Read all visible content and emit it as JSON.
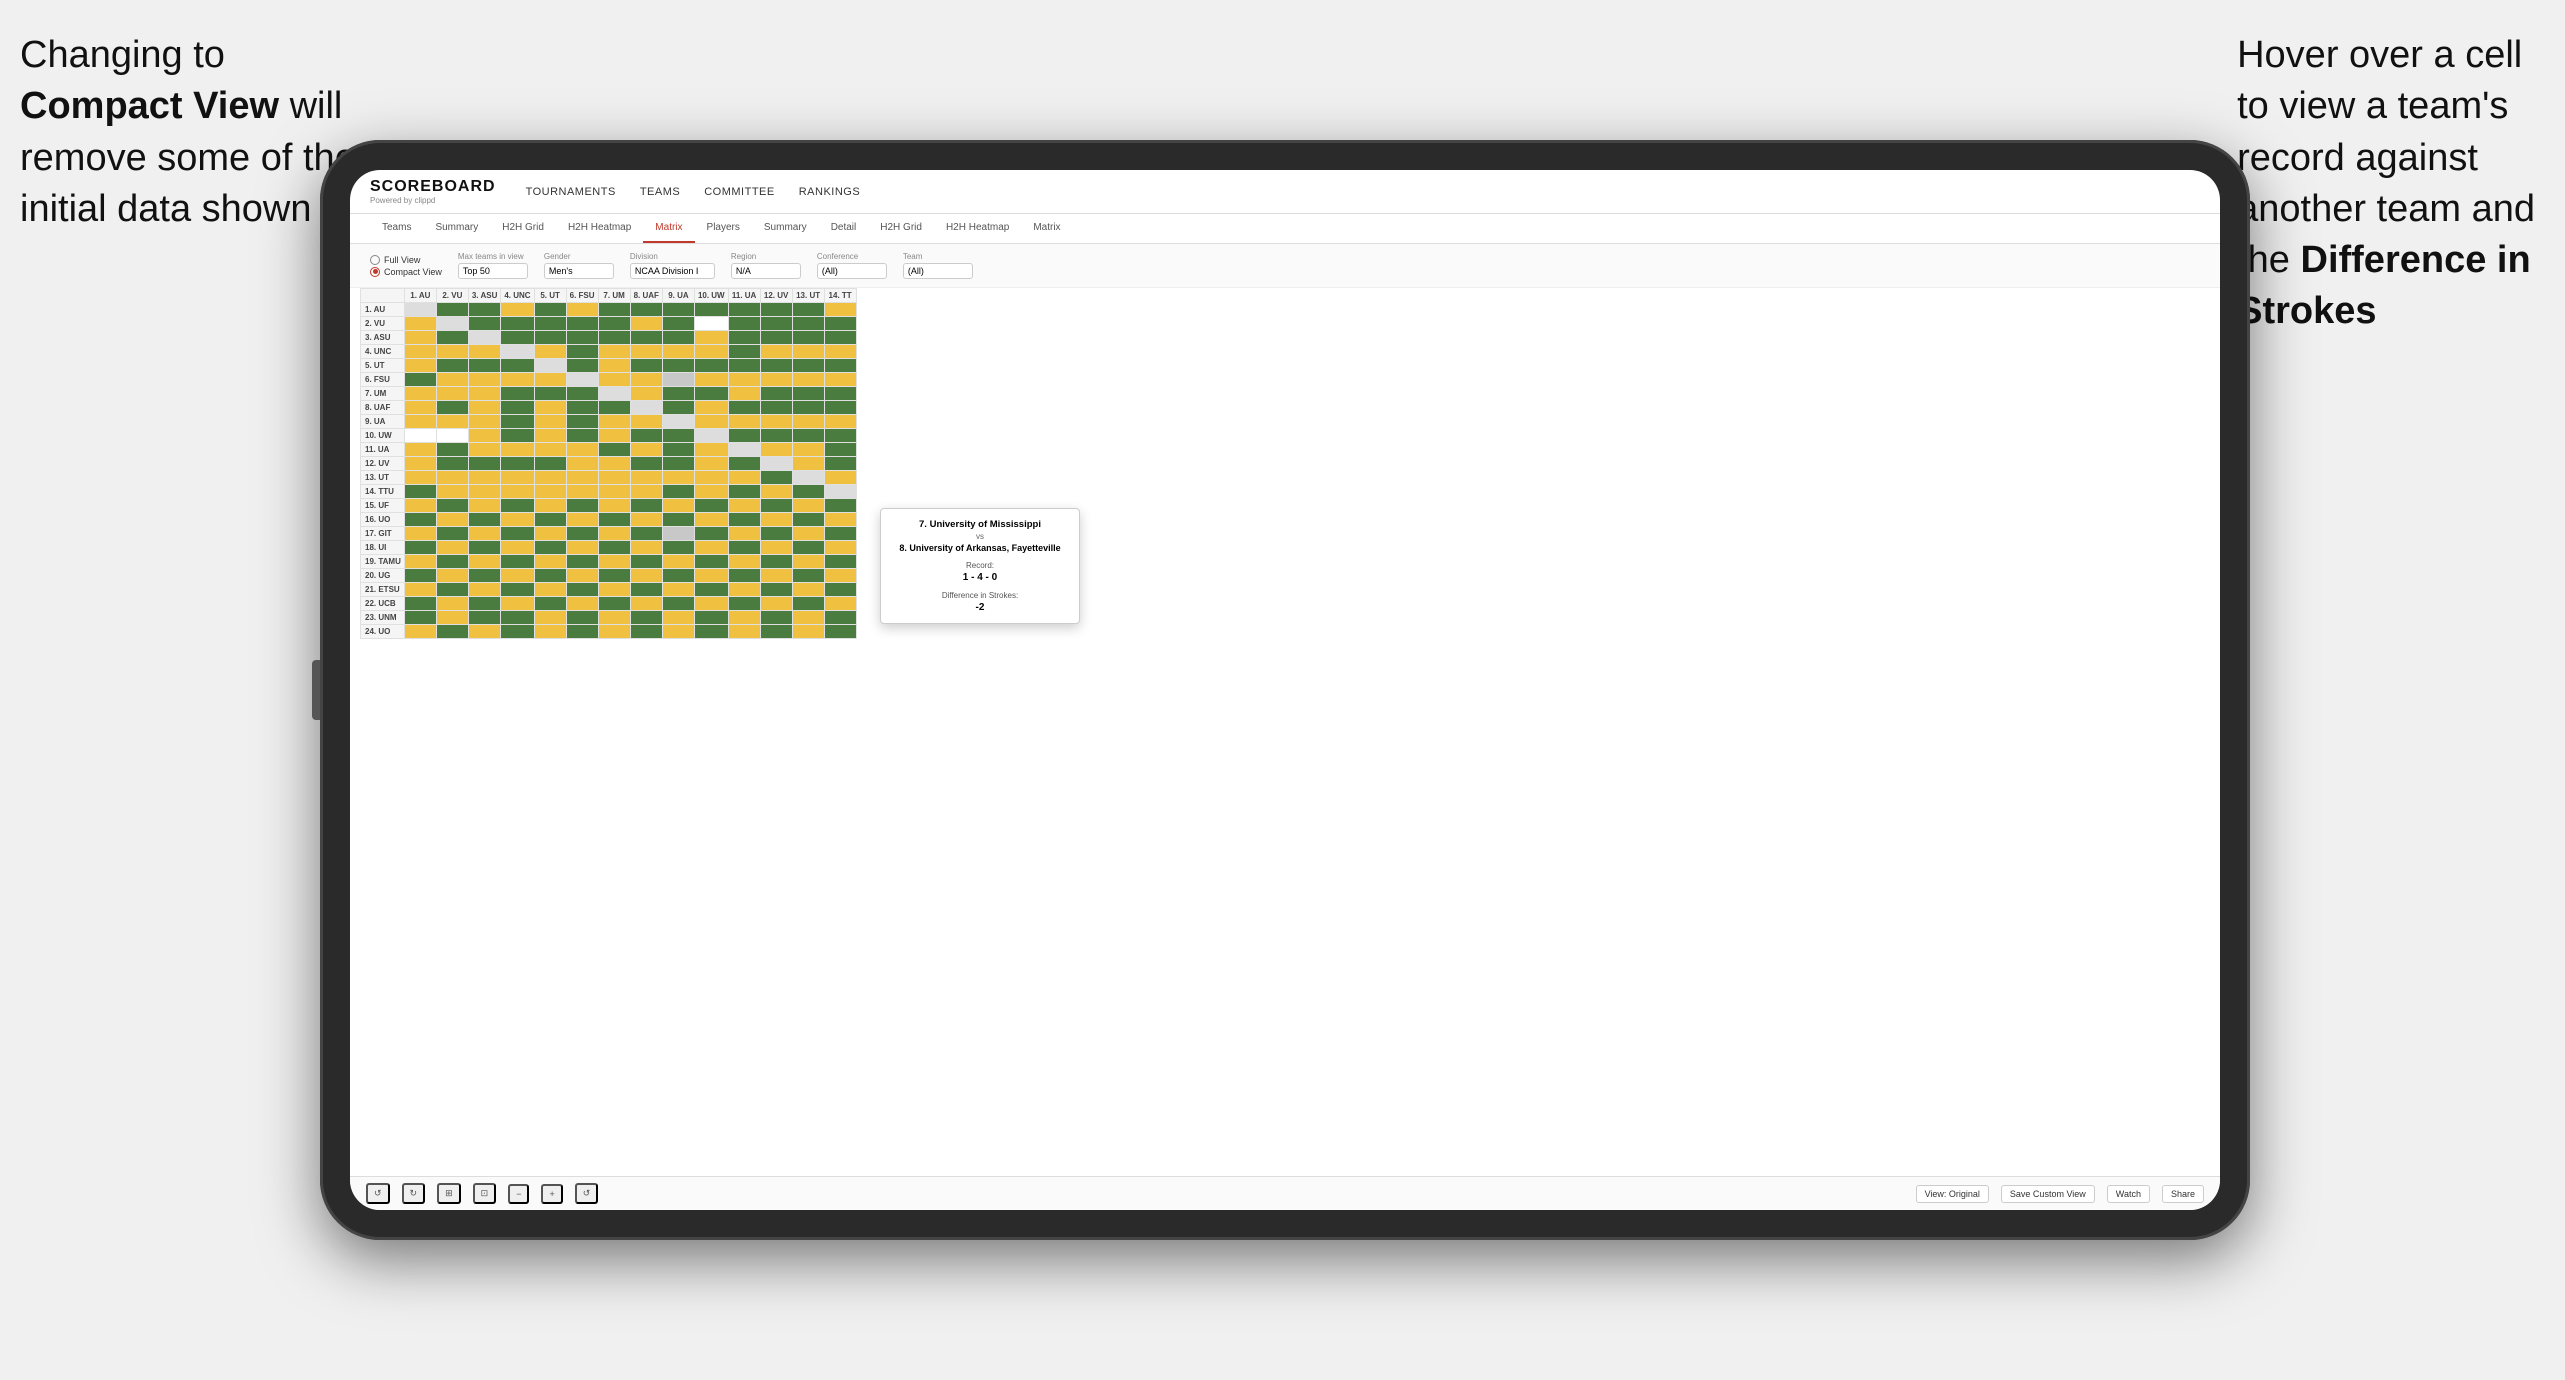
{
  "annotations": {
    "left": {
      "line1": "Changing to",
      "line2_bold": "Compact View",
      "line2_rest": " will",
      "line3": "remove some of the",
      "line4": "initial data shown"
    },
    "right": {
      "line1": "Hover over a cell",
      "line2": "to view a team's",
      "line3": "record against",
      "line4": "another team and",
      "line5_pre": "the ",
      "line5_bold": "Difference in",
      "line6_bold": "Strokes"
    }
  },
  "app": {
    "logo": "SCOREBOARD",
    "logo_sub": "Powered by clippd",
    "nav_items": [
      "TOURNAMENTS",
      "TEAMS",
      "COMMITTEE",
      "RANKINGS"
    ],
    "sub_nav_teams": [
      "Teams",
      "Summary",
      "H2H Grid",
      "H2H Heatmap",
      "Matrix"
    ],
    "sub_nav_players": [
      "Players",
      "Summary",
      "Detail",
      "H2H Grid",
      "H2H Heatmap",
      "Matrix"
    ],
    "active_tab": "Matrix",
    "view_options": {
      "full_view": "Full View",
      "compact_view": "Compact View",
      "selected": "compact"
    },
    "filters": {
      "max_teams": {
        "label": "Max teams in view",
        "value": "Top 50"
      },
      "gender": {
        "label": "Gender",
        "value": "Men's"
      },
      "division": {
        "label": "Division",
        "value": "NCAA Division I"
      },
      "region": {
        "label": "Region",
        "value": "N/A"
      },
      "conference": {
        "label": "Conference",
        "value": "(All)"
      },
      "team": {
        "label": "Team",
        "value": "(All)"
      }
    },
    "col_headers": [
      "1. AU",
      "2. VU",
      "3. ASU",
      "4. UNC",
      "5. UT",
      "6. FSU",
      "7. UM",
      "8. UAF",
      "9. UA",
      "10. UW",
      "11. UA",
      "12. UV",
      "13. UT",
      "14. TT"
    ],
    "row_labels": [
      "1. AU",
      "2. VU",
      "3. ASU",
      "4. UNC",
      "5. UT",
      "6. FSU",
      "7. UM",
      "8. UAF",
      "9. UA",
      "10. UW",
      "11. UA",
      "12. UV",
      "13. UT",
      "14. TTU",
      "15. UF",
      "16. UO",
      "17. GIT",
      "18. UI",
      "19. TAMU",
      "20. UG",
      "21. ETSU",
      "22. UCB",
      "23. UNM",
      "24. UO"
    ],
    "tooltip": {
      "team1": "7. University of Mississippi",
      "vs": "vs",
      "team2": "8. University of Arkansas, Fayetteville",
      "record_label": "Record:",
      "record_value": "1 - 4 - 0",
      "strokes_label": "Difference in Strokes:",
      "strokes_value": "-2"
    },
    "toolbar": {
      "undo": "↺",
      "redo": "↻",
      "view_original": "View: Original",
      "save_custom": "Save Custom View",
      "watch": "Watch",
      "share": "Share"
    }
  }
}
